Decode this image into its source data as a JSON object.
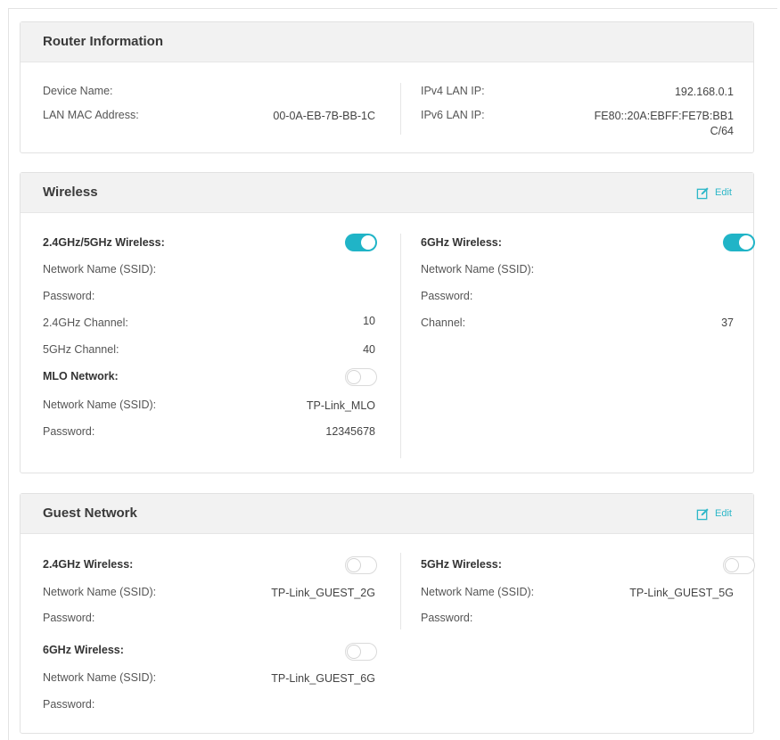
{
  "router_info": {
    "title": "Router Information",
    "device_name_label": "Device Name:",
    "lan_mac_label": "LAN MAC Address:",
    "lan_mac_value": "00-0A-EB-7B-BB-1C",
    "ipv4_label": "IPv4 LAN IP:",
    "ipv4_value": "192.168.0.1",
    "ipv6_label": "IPv6 LAN IP:",
    "ipv6_value_line1": "FE80::20A:EBFF:FE7B:BB1",
    "ipv6_value_line2": "C/64"
  },
  "wireless": {
    "title": "Wireless",
    "edit_label": "Edit",
    "band24_5_label": "2.4GHz/5GHz Wireless:",
    "band24_5_enabled": true,
    "ssid_label_left": "Network Name (SSID):",
    "password_label_left": "Password:",
    "ch24_label": "2.4GHz Channel:",
    "ch24_value": "10",
    "ch5_label": "5GHz Channel:",
    "ch5_value": "40",
    "mlo_label": "MLO Network:",
    "mlo_enabled": false,
    "mlo_ssid_label": "Network Name (SSID):",
    "mlo_ssid_value": "TP-Link_MLO",
    "mlo_password_label": "Password:",
    "mlo_password_value": "12345678",
    "band6_label": "6GHz Wireless:",
    "band6_enabled": true,
    "ssid_label_right": "Network Name (SSID):",
    "password_label_right": "Password:",
    "ch6_label": "Channel:",
    "ch6_value": "37"
  },
  "guest": {
    "title": "Guest Network",
    "edit_label": "Edit",
    "g24_label": "2.4GHz Wireless:",
    "g24_enabled": false,
    "g24_ssid_label": "Network Name (SSID):",
    "g24_ssid_value": "TP-Link_GUEST_2G",
    "g24_password_label": "Password:",
    "g6_label": "6GHz Wireless:",
    "g6_enabled": false,
    "g6_ssid_label": "Network Name (SSID):",
    "g6_ssid_value": "TP-Link_GUEST_6G",
    "g6_password_label": "Password:",
    "g5_label": "5GHz Wireless:",
    "g5_enabled": false,
    "g5_ssid_label": "Network Name (SSID):",
    "g5_ssid_value": "TP-Link_GUEST_5G",
    "g5_password_label": "Password:"
  },
  "colors": {
    "accent": "#20b4c7",
    "header_bg": "#f2f2f2"
  }
}
